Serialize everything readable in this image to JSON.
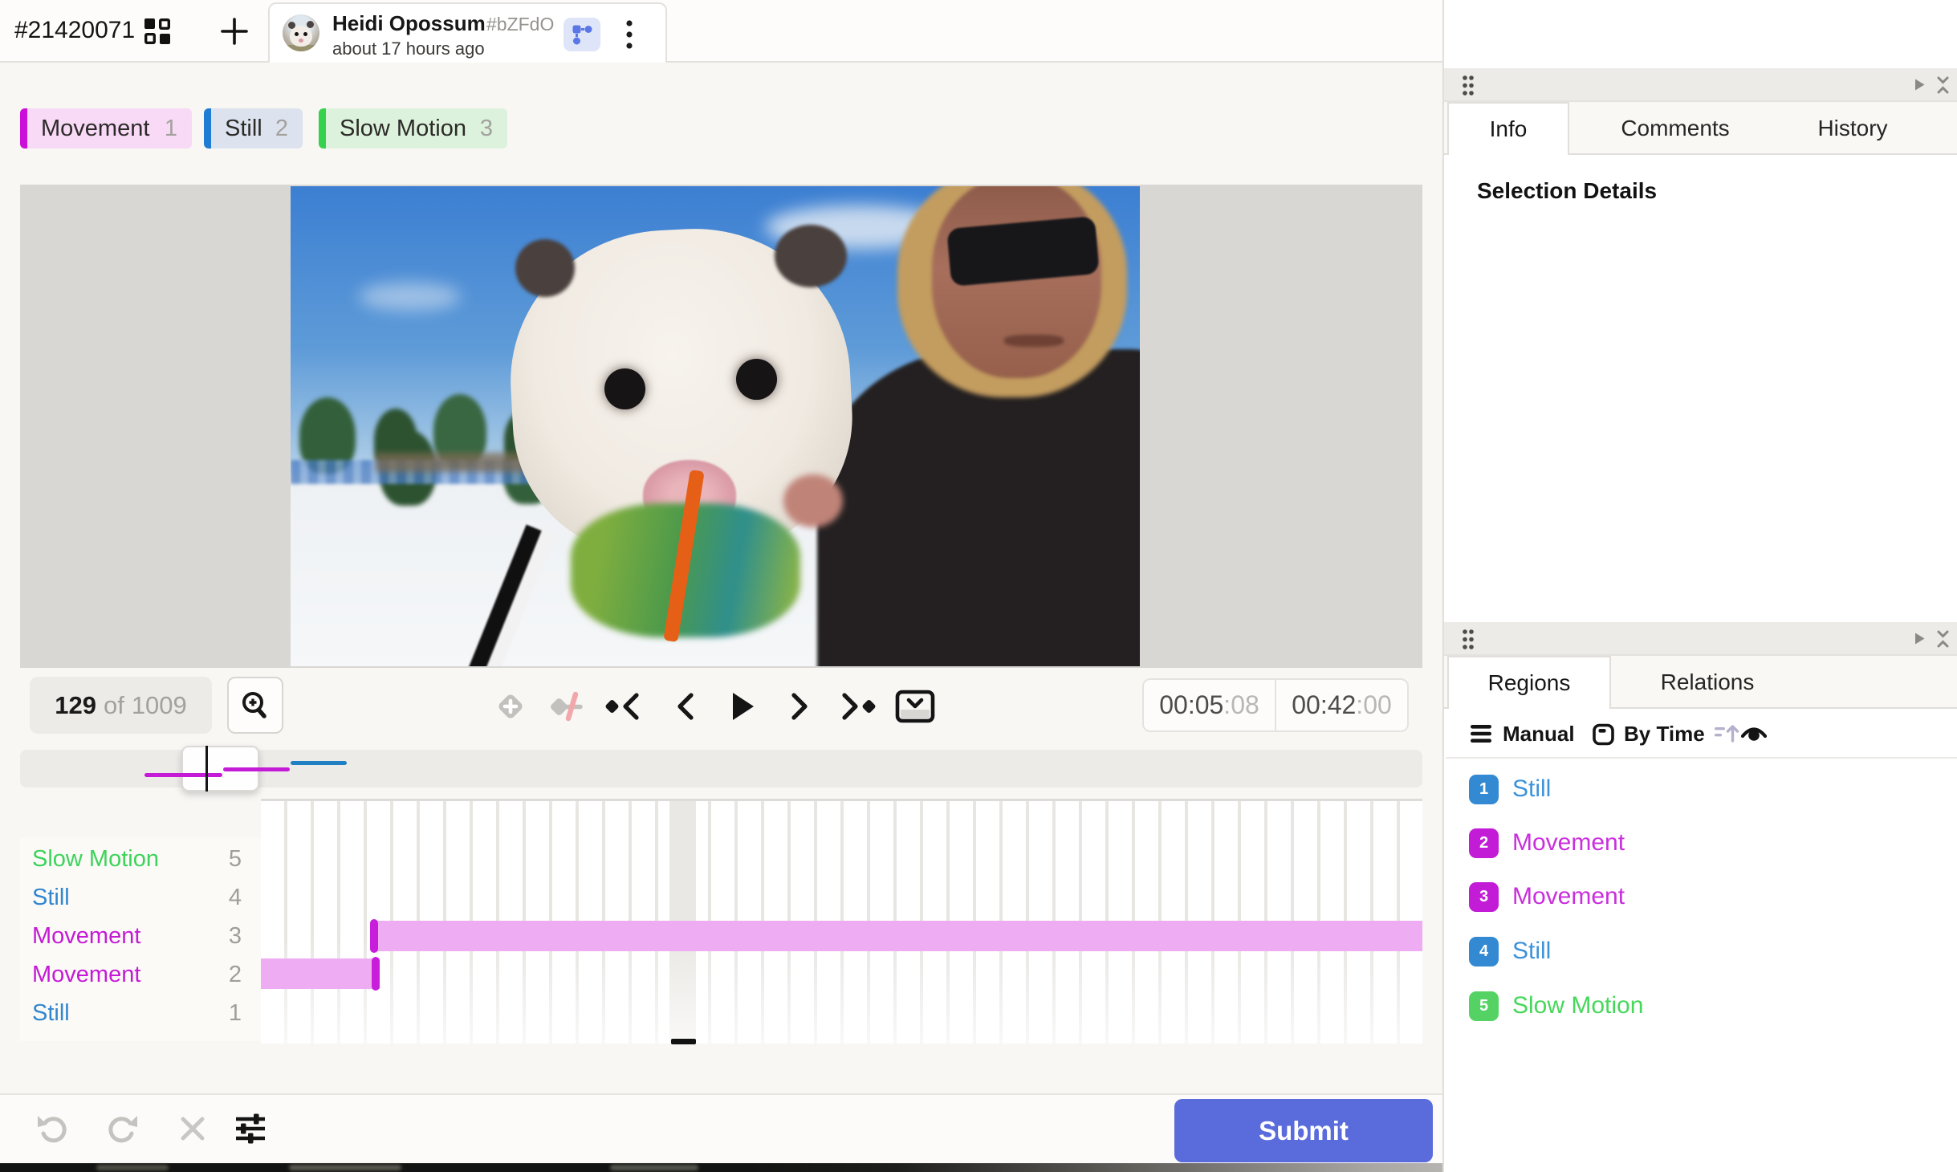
{
  "top_bar": {
    "task_id": "#21420071",
    "user_name": "Heidi Opossum",
    "user_hash": "#bZFdO",
    "time_ago": "about 17 hours ago"
  },
  "label_chips": [
    {
      "label": "Movement",
      "hotkey": "1",
      "accent": "#cc0fd8",
      "bg": "#f8d9f6"
    },
    {
      "label": "Still",
      "hotkey": "2",
      "accent": "#1e7cd2",
      "bg": "#dde3ee"
    },
    {
      "label": "Slow Motion",
      "hotkey": "3",
      "accent": "#36d14d",
      "bg": "#dcf2dc"
    }
  ],
  "player": {
    "frame_current": "129",
    "frame_separator": "of",
    "frame_total": "1009",
    "time_position": "00:05",
    "time_position_frames": ":08",
    "time_total": "00:42",
    "time_total_frames": ":00"
  },
  "tracks": [
    {
      "label": "Slow Motion",
      "num": "5",
      "color": "#3dd35b"
    },
    {
      "label": "Still",
      "num": "4",
      "color": "#3186cf"
    },
    {
      "label": "Movement",
      "num": "3",
      "color": "#c41ad5"
    },
    {
      "label": "Movement",
      "num": "2",
      "color": "#c41ad5"
    },
    {
      "label": "Still",
      "num": "1",
      "color": "#3186cf"
    }
  ],
  "timeline": {
    "region_bar_color": "#eeadf2",
    "keyframe_color": "#c81ddb",
    "minimap_blue": "#2180c4",
    "minimap_magenta": "#c41bd6"
  },
  "panels": {
    "info_tabs": {
      "info": "Info",
      "comments": "Comments",
      "history": "History"
    },
    "selection_title": "Selection Details",
    "regions_tabs": {
      "regions": "Regions",
      "relations": "Relations"
    },
    "toolbar": {
      "manual": "Manual",
      "by_time": "By Time"
    },
    "regions": [
      {
        "num": "1",
        "label": "Still",
        "color": "#338ad2"
      },
      {
        "num": "2",
        "label": "Movement",
        "color": "#c21cd6"
      },
      {
        "num": "3",
        "label": "Movement",
        "color": "#c21cd6"
      },
      {
        "num": "4",
        "label": "Still",
        "color": "#338ad2"
      },
      {
        "num": "5",
        "label": "Slow Motion",
        "color": "#54d364"
      }
    ]
  },
  "bottom": {
    "submit": "Submit",
    "submit_color": "#5a6bdc"
  },
  "icons": {
    "grid-view": "▦",
    "add-annotation": "+",
    "relations-toggle": "node-link",
    "kebab": "⋮",
    "zoom-in": "⊕",
    "add-keyframe": "◇+",
    "keyframe-slash": "◇/",
    "prev-keyframe": "◆❮",
    "prev-frame": "❮",
    "play": "▶",
    "next-frame": "❯",
    "next-keyframe": "❯◆",
    "collapse-frames": "⊡",
    "undo": "↺",
    "redo": "↻",
    "delete": "✕",
    "settings-sliders": "☰",
    "drag-handle": "⠿",
    "expand-panel": "▶",
    "collapse-panel": "≍",
    "manual-sort": "☰",
    "by-time-sort": "▭",
    "sort-arrow": "↑",
    "visibility-eye": "◉"
  }
}
